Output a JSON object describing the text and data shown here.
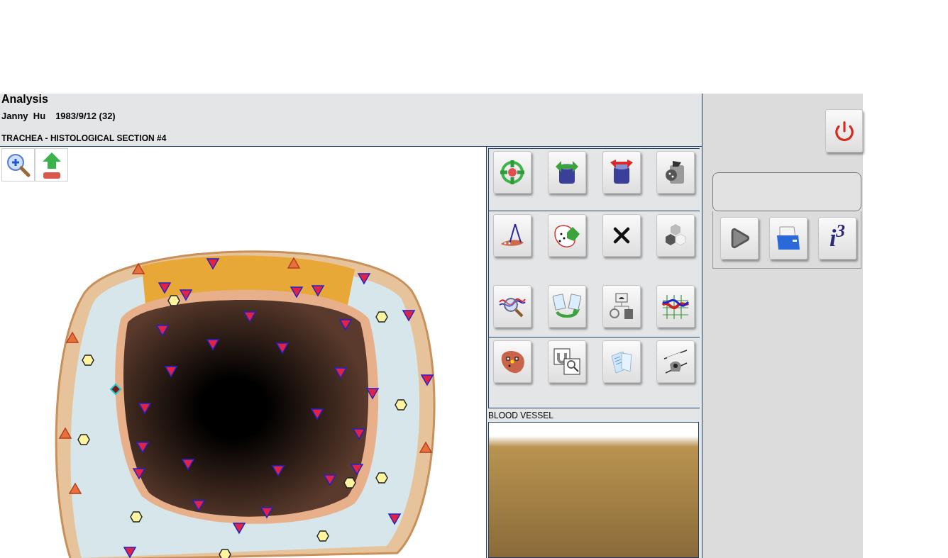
{
  "window": {
    "title": "Analysis"
  },
  "patient": {
    "name": "Janny  Hu",
    "birth": "1983/9/12 (32)"
  },
  "section": {
    "title": "TRACHEA - HISTOLOGICAL SECTION #4"
  },
  "preview": {
    "title": "BLOOD VESSEL"
  },
  "info_button": {
    "label": "i$^{3}$"
  }
}
